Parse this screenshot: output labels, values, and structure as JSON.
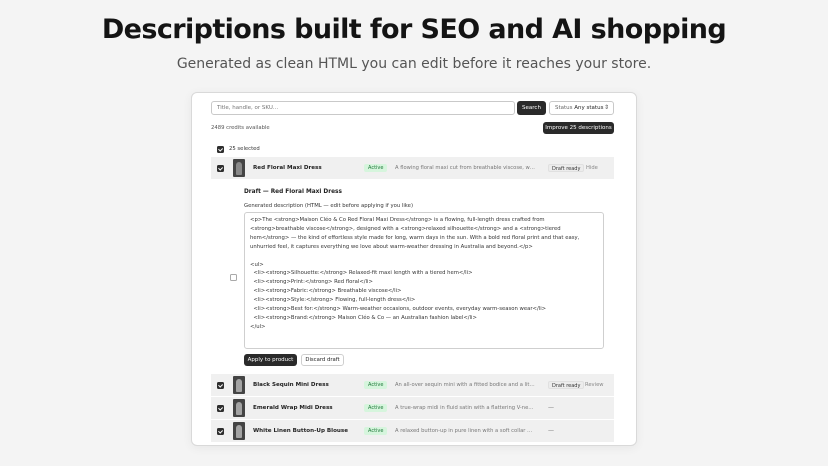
{
  "hero": {
    "title": "Descriptions built for SEO and AI shopping",
    "subtitle": "Generated as clean HTML you can edit before it reaches your store."
  },
  "toolbar": {
    "search_placeholder": "Title, handle, or SKU...",
    "search_button": "Search",
    "status_label": "Status",
    "status_value": "Any status",
    "credits": "2489 credits available",
    "improve_button": "Improve 25 descriptions"
  },
  "selection": {
    "label": "25 selected"
  },
  "products": [
    {
      "name": "Red Floral Maxi Dress",
      "status": "Active",
      "description": "A flowing floral maxi cut from breathable viscose, wit...",
      "draft_status": "Draft ready",
      "action": "Hide",
      "checked": true
    },
    {
      "name": "Black Sequin Mini Dress",
      "status": "Active",
      "description": "An all-over sequin mini with a fitted bodice and a little ...",
      "draft_status": "Draft ready",
      "action": "Review",
      "checked": true
    },
    {
      "name": "Emerald Wrap Midi Dress",
      "status": "Active",
      "description": "A true-wrap midi in fluid satin with a flattering V-neck ...",
      "draft_status": "—",
      "action": "",
      "checked": true
    },
    {
      "name": "White Linen Button-Up Blouse",
      "status": "Active",
      "description": "A relaxed button-up in pure linen with a soft collar and...",
      "draft_status": "—",
      "action": "",
      "checked": true
    }
  ],
  "draft": {
    "title": "Draft — Red Floral Maxi Dress",
    "label": "Generated description (HTML — edit before applying if you like)",
    "html": "<p>The <strong>Maison Cléo & Co Red Floral Maxi Dress</strong> is a flowing, full-length dress crafted from <strong>breathable viscose</strong>, designed with a <strong>relaxed silhouette</strong> and a <strong>tiered hem</strong> — the kind of effortless style made for long, warm days in the sun. With a bold red floral print and that easy, unhurried feel, it captures everything we love about warm-weather dressing in Australia and beyond.</p>\n\n<ul>\n  <li><strong>Silhouette:</strong> Relaxed-fit maxi length with a tiered hem</li>\n  <li><strong>Print:</strong> Red floral</li>\n  <li><strong>Fabric:</strong> Breathable viscose</li>\n  <li><strong>Style:</strong> Flowing, full-length dress</li>\n  <li><strong>Best for:</strong> Warm-weather occasions, outdoor events, everyday warm-season wear</li>\n  <li><strong>Brand:</strong> Maison Cléo & Co — an Australian fashion label</li>\n</ul>",
    "apply_button": "Apply to product",
    "discard_button": "Discard draft"
  },
  "colors": {
    "primary_button": "#2a2a2a",
    "active_badge_bg": "#d6f5dd",
    "active_badge_text": "#1f7a3a"
  }
}
